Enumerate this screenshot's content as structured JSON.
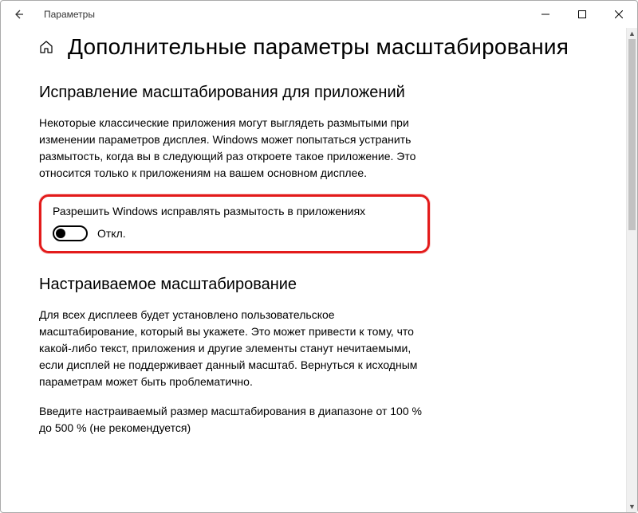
{
  "titlebar": {
    "title": "Параметры"
  },
  "page": {
    "title": "Дополнительные параметры масштабирования"
  },
  "section1": {
    "heading": "Исправление масштабирования для приложений",
    "description": "Некоторые классические приложения могут выглядеть размытыми при изменении параметров дисплея. Windows может попытаться устранить размытость, когда вы в следующий раз откроете такое приложение. Это относится только к приложениям на вашем основном дисплее.",
    "toggle_label": "Разрешить Windows исправлять размытость в приложениях",
    "toggle_state": "Откл."
  },
  "section2": {
    "heading": "Настраиваемое масштабирование",
    "description": "Для всех дисплеев будет установлено пользовательское масштабирование, который вы укажете. Это может привести к тому, что какой-либо текст, приложения и другие элементы станут нечитаемыми, если дисплей не поддерживает данный масштаб. Вернуться к исходным параметрам может быть проблематично.",
    "hint": "Введите настраиваемый размер масштабирования в диапазоне от 100 % до 500 % (не рекомендуется)"
  }
}
